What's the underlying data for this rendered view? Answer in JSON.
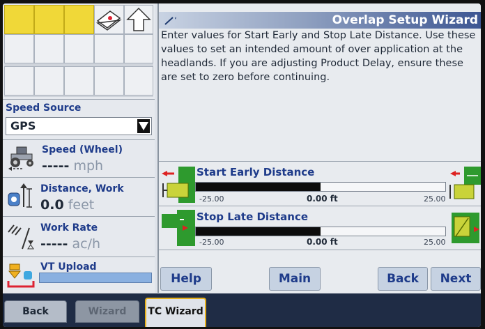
{
  "left_panel": {
    "speed_source": {
      "label": "Speed Source",
      "value": "GPS"
    },
    "speed": {
      "label": "Speed (Wheel)",
      "value": "-----",
      "unit": "mph",
      "icon": "tractor-icon"
    },
    "distance": {
      "label": "Distance, Work",
      "value": "0.0",
      "unit": "feet",
      "icon": "distance-odometer-icon"
    },
    "work_rate": {
      "label": "Work Rate",
      "value": "-----",
      "unit": "ac/h",
      "icon": "work-rate-icon"
    },
    "vt_upload": {
      "label": "VT Upload",
      "icon": "upload-icon"
    }
  },
  "wizard": {
    "title": "Overlap Setup Wizard",
    "description": "Enter values for Start Early and Stop Late Distance. Use these values to set an intended amount of over application at the headlands. If you are adjusting Product Delay, ensure these are set to zero before continuing.",
    "start_early": {
      "label": "Start Early Distance",
      "min": "-25.00",
      "max": "25.00",
      "value": "0.00 ft",
      "fill_fraction": 0.5
    },
    "stop_late": {
      "label": "Stop Late Distance",
      "min": "-25.00",
      "max": "25.00",
      "value": "0.00 ft",
      "fill_fraction": 0.5
    },
    "buttons": {
      "help": "Help",
      "main": "Main",
      "back": "Back",
      "next": "Next"
    }
  },
  "tabs": {
    "back": "Back",
    "wizard": "Wizard",
    "tc_wizard": "TC Wizard"
  },
  "colors": {
    "accent_green": "#2e9a2e",
    "title_blue": "#3c5592",
    "label_blue": "#1e3b8a",
    "highlight_yellow": "#f0d838"
  }
}
